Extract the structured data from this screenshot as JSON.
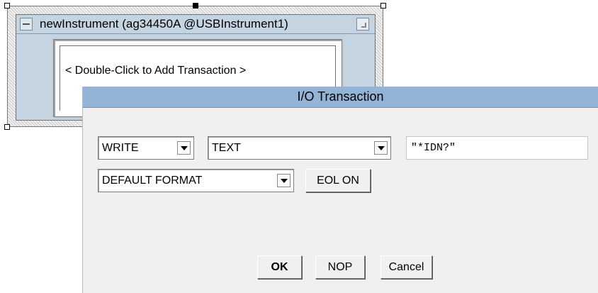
{
  "instrument": {
    "title": "newInstrument (ag34450A @USBInstrument1)",
    "hint": "< Double-Click to Add Transaction >",
    "minimize_icon": "minimize-icon",
    "restore_icon": "restore-icon"
  },
  "dialog": {
    "title": "I/O Transaction",
    "action_select": {
      "value": "WRITE"
    },
    "type_select": {
      "value": "TEXT"
    },
    "command_field": {
      "value": "\"*IDN?\""
    },
    "format_select": {
      "value": "DEFAULT FORMAT"
    },
    "eol_button": "EOL ON",
    "ok_button": "OK",
    "nop_button": "NOP",
    "cancel_button": "Cancel"
  },
  "colors": {
    "dialog_title_bar": "#93b4d6",
    "instrument_window": "#c4d4e0",
    "dialog_body": "#f0f0f0"
  }
}
